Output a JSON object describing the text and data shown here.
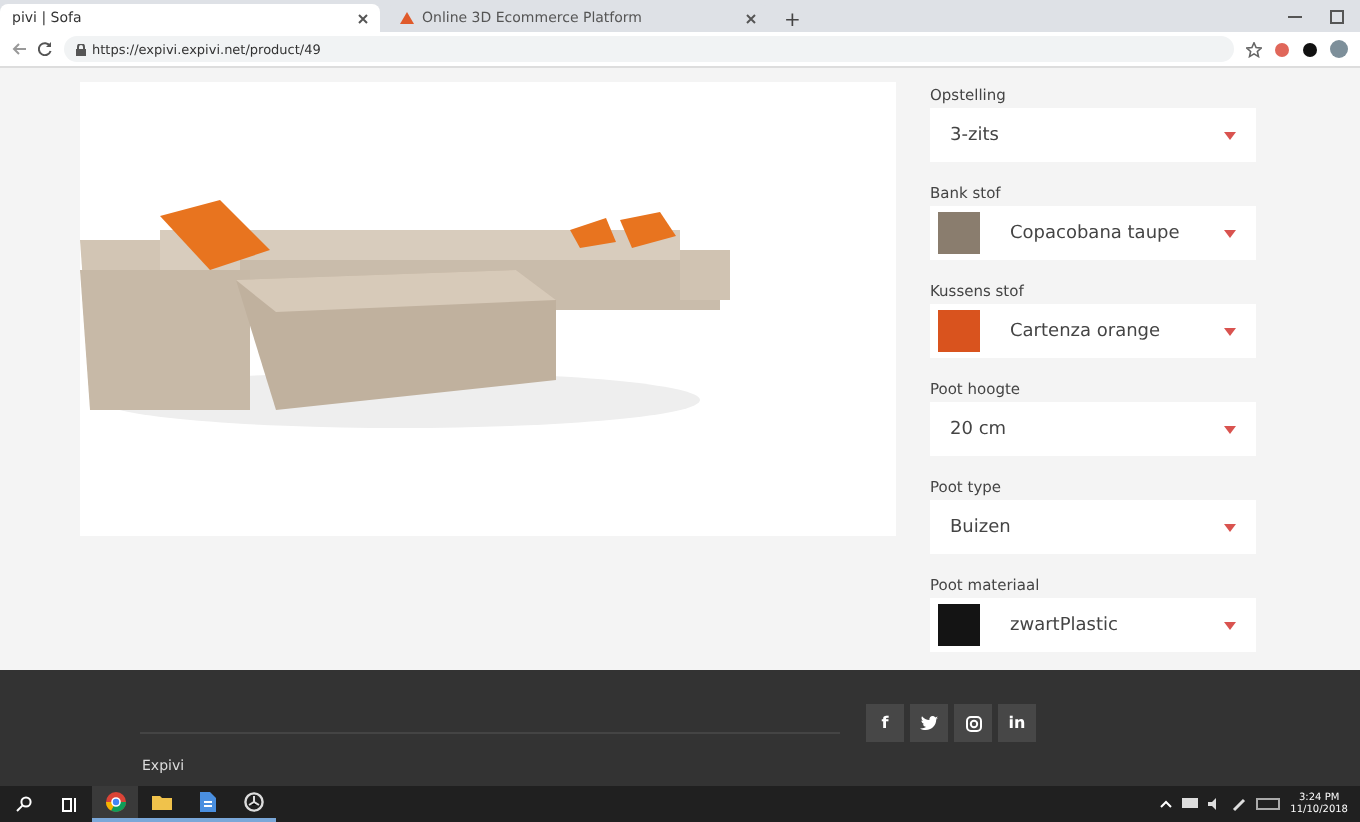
{
  "browser": {
    "tabs": [
      {
        "title": "pivi | Sofa",
        "selected": true
      },
      {
        "title": "Online 3D Ecommerce Platform",
        "selected": false
      }
    ],
    "new_tab": "+",
    "url": "https://expivi.expivi.net/product/49"
  },
  "options": [
    {
      "label": "Opstelling",
      "value": "3-zits",
      "kind": "plain"
    },
    {
      "label": "Bank stof",
      "value": "Copacobana taupe",
      "kind": "swatch",
      "color": "#8a7d6e"
    },
    {
      "label": "Kussens stof",
      "value": "Cartenza orange",
      "kind": "swatch",
      "color": "#d9531e"
    },
    {
      "label": "Poot hoogte",
      "value": "20 cm",
      "kind": "plain"
    },
    {
      "label": "Poot type",
      "value": "Buizen",
      "kind": "plain"
    },
    {
      "label": "Poot materiaal",
      "value": "zwartPlastic",
      "kind": "swatch",
      "color": "#141414"
    }
  ],
  "footer": {
    "brand": "Expivi",
    "socials": [
      {
        "kind": "text",
        "label": "f"
      },
      {
        "kind": "twitter"
      },
      {
        "kind": "instagram"
      },
      {
        "kind": "text",
        "label": "in"
      }
    ]
  },
  "taskbar": {
    "time": "3:24 PM",
    "date": "11/10/2018"
  }
}
